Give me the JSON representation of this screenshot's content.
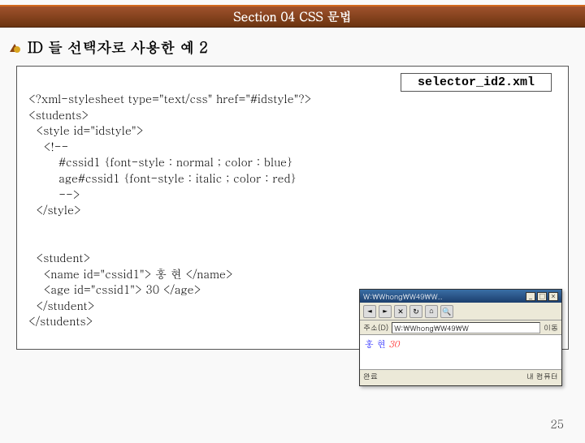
{
  "header": {
    "title": "Section 04 CSS 문법"
  },
  "subtitle": "ID 들 선택자로 사용한 예 2",
  "file_label": "selector_id2.xml",
  "code": {
    "line1": "<?xml-stylesheet type=\"text/css\" href=\"#idstyle\"?>",
    "line2": "<students>",
    "line3": "  <style id=\"idstyle\">",
    "line4": "    <!--",
    "line5": "        #cssid1 {font-style : normal ; color : blue}",
    "line6": "        age#cssid1 {font-style : italic ; color : red}",
    "line7": "        -->",
    "line8": "  </style>",
    "line9": "",
    "line10": "  <student>",
    "line11": "    <name id=\"cssid1\"> 홍 현 </name>",
    "line12": "    <age id=\"cssid1\"> 30 </age>",
    "line13": "  </student>",
    "line14": "</students>"
  },
  "browser": {
    "title_text": "W:\\Whong\\W49\\W..",
    "toolbar_items": [
      "뒤로",
      "앞",
      "중지",
      "새로",
      "홈",
      "검색"
    ],
    "address_label": "주소(D)",
    "address_value": "W:\\Whong\\W49\\W",
    "go_label": "이동",
    "content_name": "홍 현",
    "content_age": "30",
    "content_sep": " / ",
    "status_left": "완료",
    "status_right": "내 컴퓨터"
  },
  "page_number": "25"
}
